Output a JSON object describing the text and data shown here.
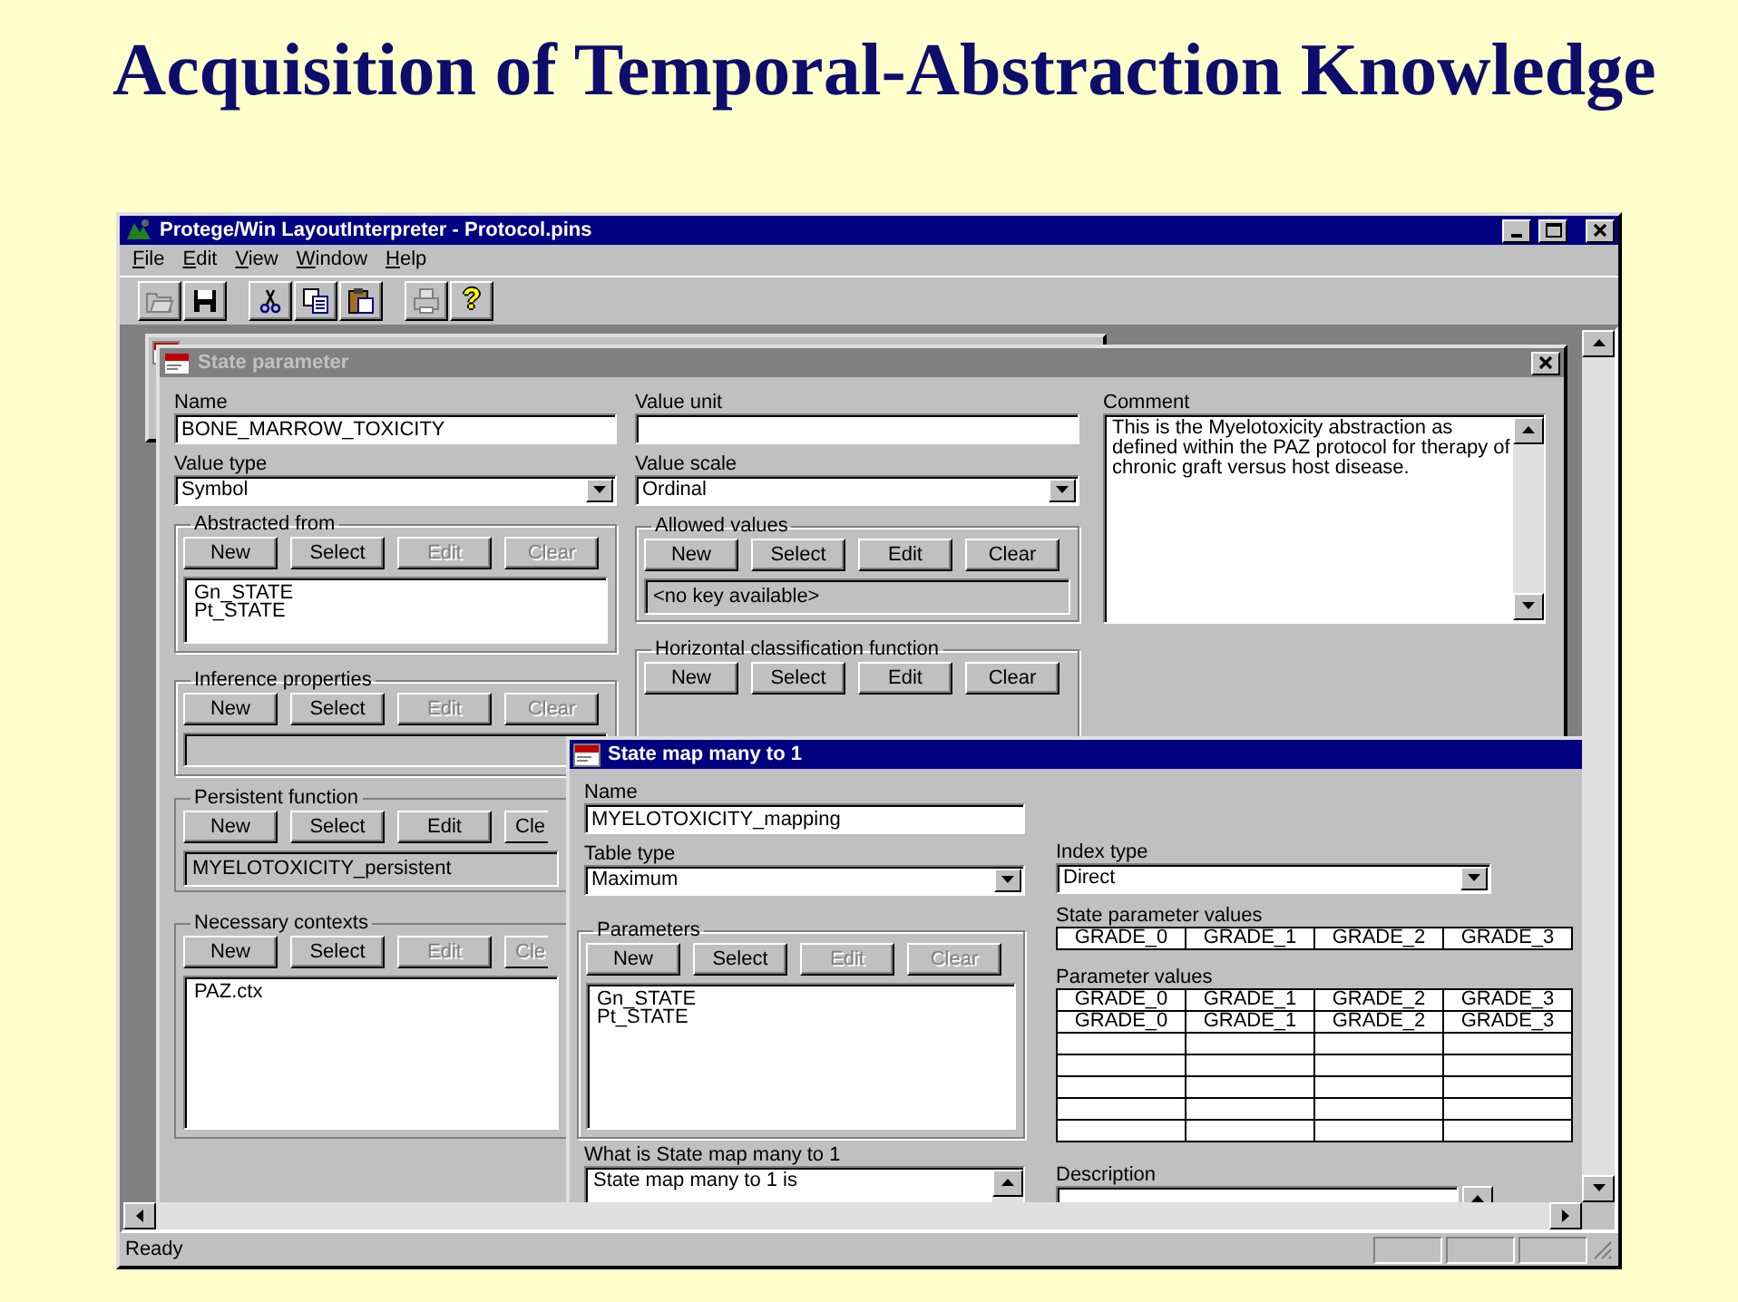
{
  "slide_title": "Acquisition of Temporal-Abstraction Knowledge",
  "app_window": {
    "title": "Protege/Win LayoutInterpreter - Protocol.pins",
    "active": true
  },
  "menu": [
    "File",
    "Edit",
    "View",
    "Window",
    "Help"
  ],
  "toolbar": [
    [
      {
        "kind": "open",
        "disabled": true
      },
      {
        "kind": "save",
        "disabled": false
      }
    ],
    [
      {
        "kind": "cut",
        "disabled": false
      },
      {
        "kind": "copy",
        "disabled": false
      },
      {
        "kind": "paste",
        "disabled": false
      }
    ],
    [
      {
        "kind": "print",
        "disabled": true
      },
      {
        "kind": "help",
        "label": "?",
        "disabled": false
      }
    ]
  ],
  "state_parameter": {
    "title": "State parameter",
    "active": false,
    "name": {
      "label": "Name",
      "value": "BONE_MARROW_TOXICITY"
    },
    "value_type": {
      "label": "Value type",
      "value": "Symbol"
    },
    "value_unit": {
      "label": "Value unit"
    },
    "value_scale": {
      "label": "Value scale",
      "value": "Ordinal"
    },
    "comment": {
      "label": "Comment",
      "value": "This is the Myelotoxicity abstraction as defined within the PAZ protocol for therapy of chronic graft versus host disease."
    },
    "left_groups": [
      {
        "kind": "list",
        "title": "Abstracted from",
        "covered": false,
        "buttons": [
          {
            "label": "New",
            "disabled": false
          },
          {
            "label": "Select",
            "disabled": false
          },
          {
            "label": "Edit",
            "disabled": true
          },
          {
            "label": "Clear",
            "disabled": true
          }
        ],
        "items": [
          "Gn_STATE",
          "Pt_STATE"
        ]
      },
      {
        "kind": "display",
        "title": "Inference properties",
        "covered": false,
        "buttons": [
          {
            "label": "New",
            "disabled": false
          },
          {
            "label": "Select",
            "disabled": false
          },
          {
            "label": "Edit",
            "disabled": true
          },
          {
            "label": "Clear",
            "disabled": true
          }
        ]
      },
      {
        "kind": "display",
        "title": "Persistent function",
        "covered": true,
        "buttons": [
          {
            "label": "New",
            "disabled": false
          },
          {
            "label": "Select",
            "disabled": false
          },
          {
            "label": "Edit",
            "disabled": false
          },
          {
            "label": "Cle",
            "disabled": false
          }
        ],
        "value": "MYELOTOXICITY_persistent"
      },
      {
        "kind": "list",
        "title": "Necessary contexts",
        "covered": true,
        "buttons": [
          {
            "label": "New",
            "disabled": false
          },
          {
            "label": "Select",
            "disabled": false
          },
          {
            "label": "Edit",
            "disabled": true
          },
          {
            "label": "Cle",
            "disabled": true
          }
        ],
        "items": [
          "PAZ.ctx"
        ]
      }
    ],
    "middle_groups": [
      {
        "kind": "display",
        "title": "Allowed values",
        "covered": false,
        "buttons": [
          {
            "label": "New",
            "disabled": false
          },
          {
            "label": "Select",
            "disabled": false
          },
          {
            "label": "Edit",
            "disabled": false
          },
          {
            "label": "Clear",
            "disabled": false
          }
        ],
        "value": "<no key available>"
      },
      {
        "kind": "none",
        "title": "Horizontal classification function",
        "covered": false,
        "buttons": [
          {
            "label": "New",
            "disabled": false
          },
          {
            "label": "Select",
            "disabled": false
          },
          {
            "label": "Edit",
            "disabled": false
          },
          {
            "label": "Clear",
            "disabled": false
          }
        ]
      }
    ]
  },
  "state_map": {
    "title": "State map many to 1",
    "active": true,
    "name": {
      "label": "Name",
      "value": "MYELOTOXICITY_mapping"
    },
    "table_type": {
      "label": "Table type",
      "value": "Maximum"
    },
    "parameters": {
      "kind": "list",
      "title": "Parameters",
      "covered": false,
      "buttons": [
        {
          "label": "New",
          "disabled": false
        },
        {
          "label": "Select",
          "disabled": false
        },
        {
          "label": "Edit",
          "disabled": true
        },
        {
          "label": "Clear",
          "disabled": true
        }
      ],
      "items": [
        "Gn_STATE",
        "Pt_STATE"
      ]
    },
    "what_is": {
      "label": "What is State map many to 1",
      "value": "State map many to 1 is"
    },
    "index_type": {
      "label": "Index type",
      "value": "Direct"
    },
    "state_parameter_values": {
      "label": "State parameter values",
      "cells": [
        "GRADE_0",
        "GRADE_1",
        "GRADE_2",
        "GRADE_3"
      ]
    },
    "parameter_values": {
      "label": "Parameter values",
      "rows": [
        [
          "GRADE_0",
          "GRADE_1",
          "GRADE_2",
          "GRADE_3"
        ],
        [
          "GRADE_0",
          "GRADE_1",
          "GRADE_2",
          "GRADE_3"
        ]
      ]
    },
    "description": {
      "label": "Description"
    }
  },
  "status_bar": {
    "text": "Ready"
  }
}
